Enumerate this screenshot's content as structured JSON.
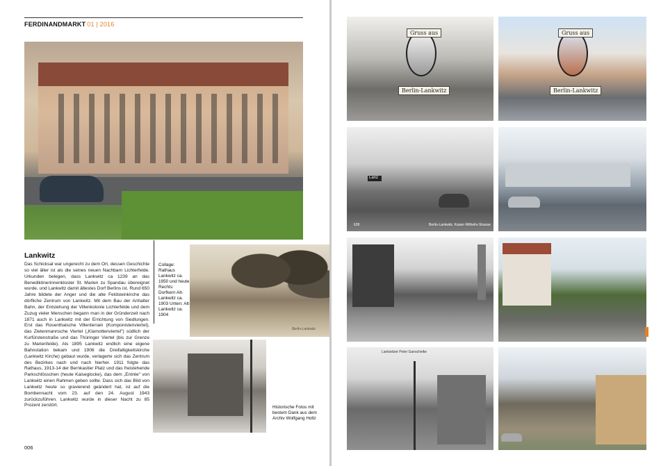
{
  "header": {
    "magazine": "FERDINANDMARKT",
    "issue": "01 | 2016"
  },
  "article": {
    "title": "Lankwitz",
    "body": "Das Schicksal war ungerecht zu dem Ort, dessen Geschichte so viel älter ist als die seines neuen Nachbarn Lichterfelde. Urkunden belegen, dass Lankwitz ca 1239 an das Benediktinerinnenkloster St. Marien zu Spandau übereignet wurde, und Lankwitz damit ältestes Dorf Berlins ist. Rund 650 Jahre bildete der Anger und die alte Feldsteinkirche das dörfliche Zentrum von Lankwitz. Mit dem Bau der Anhalter Bahn, der Entstehung der Villenkolonie Lichterfelde und dem Zuzug vieler Menschen begann man in der Gründerzeit nach 1871 auch in Lankwitz mit der Errichtung von Siedlungen. Erst das Rosenthalsche Villenterrain (Komponistenviertel), das Zietenmannsche Viertel („Klamottenviertel\") südlich der Kurfürstenstraße und das Thüringer Viertel (bis zur Grenze zu Marienfelde). Als 1895 Lankwitz endlich eine eigene Bahnstation bekam und 1906 die Dreifaltigkeitskirche (Lankwitz Kirche) gebaut wurde, verlagerte sich das Zentrum des Bezirkes nach und nach hierher. 1911 folgte das Rathaus, 1913-14 der Bernkastler Platz und das freistehende Parkschlösschen (heute Kaiseglocke), das dem „Entrée\" von Lankwitz einen Rahmen geben sollte. Dass sich das Bild von Lankwitz heute so gravierend geändert hat, ist auf die Bombennacht vom 23. auf den 24. August 1943 zurückzuführen. Lankwitz wurde in dieser Nacht zu 85 Prozent zerstört."
  },
  "captions": {
    "collage": "Collage: Rathaus Lankwitz ca. 1950 und heute Rechts: Dorfkern Alt-Lankwitz ca. 1903 Unten: Alt-Lankwitz ca. 1904",
    "historic": "Historische Fotos mit bestem Dank aus dem Archiv Wolfgang Holtz"
  },
  "photo_labels": {
    "avenue": "Berlin-Lankwitz",
    "greeting_top": "Gruss aus",
    "greeting_bottom": "Berlin-Lankwitz",
    "greeting_top_2": "Gruss aus",
    "greeting_bottom_2": "Berlin-Lankwitz",
    "street_caption": "Berlin-Lankwitz, Kaiser-Wilhelm-Strasse",
    "street_number": "628",
    "shop_sign": "Lanz",
    "postcard_title": "Lankwitzer Peter Ganschelke"
  },
  "page_number": "006",
  "colors": {
    "accent": "#e67e22",
    "text": "#1a1a1a"
  }
}
